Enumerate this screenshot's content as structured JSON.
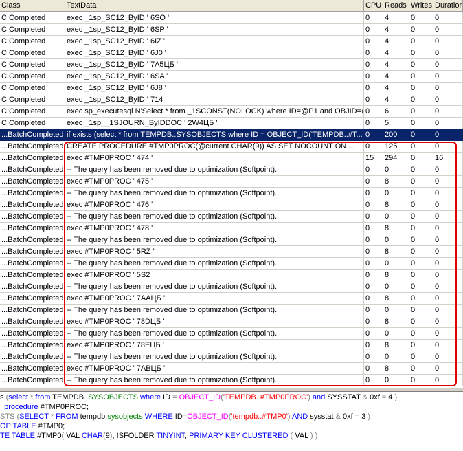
{
  "columns": [
    "Class",
    "TextData",
    "CPU",
    "Reads",
    "Writes",
    "Duration"
  ],
  "rows": [
    {
      "cls": "C:Completed",
      "text": "exec _1sp_SC12_ByID '    6SO    '",
      "cpu": "0",
      "reads": "4",
      "writes": "0",
      "duration": "0"
    },
    {
      "cls": "C:Completed",
      "text": "exec _1sp_SC12_ByID '    6SP    '",
      "cpu": "0",
      "reads": "4",
      "writes": "0",
      "duration": "0"
    },
    {
      "cls": "C:Completed",
      "text": "exec _1sp_SC12_ByID '    6IZ    '",
      "cpu": "0",
      "reads": "4",
      "writes": "0",
      "duration": "0"
    },
    {
      "cls": "C:Completed",
      "text": "exec _1sp_SC12_ByID '    6J0    '",
      "cpu": "0",
      "reads": "4",
      "writes": "0",
      "duration": "0"
    },
    {
      "cls": "C:Completed",
      "text": "exec _1sp_SC12_ByID '    7A5ЦБ '",
      "cpu": "0",
      "reads": "4",
      "writes": "0",
      "duration": "0"
    },
    {
      "cls": "C:Completed",
      "text": "exec _1sp_SC12_ByID '    6SA    '",
      "cpu": "0",
      "reads": "4",
      "writes": "0",
      "duration": "0"
    },
    {
      "cls": "C:Completed",
      "text": "exec _1sp_SC12_ByID '    6J8    '",
      "cpu": "0",
      "reads": "4",
      "writes": "0",
      "duration": "0"
    },
    {
      "cls": "C:Completed",
      "text": "exec _1sp_SC12_ByID '    714    '",
      "cpu": "0",
      "reads": "4",
      "writes": "0",
      "duration": "0"
    },
    {
      "cls": "C:Completed",
      "text": "exec sp_executesql N'Select * from _1SCONST(NOLOCK) where ID=@P1 and OBJID=@...",
      "cpu": "0",
      "reads": "6",
      "writes": "0",
      "duration": "0"
    },
    {
      "cls": "C:Completed",
      "text": "exec _1sp__1SJOURN_ByIDDOC '    2W4ЦБ '",
      "cpu": "0",
      "reads": "5",
      "writes": "0",
      "duration": "0"
    },
    {
      "cls": "...BatchCompleted",
      "text": "if exists (select * from TEMPDB..SYSOBJECTS where ID = OBJECT_ID('TEMPDB..#T...",
      "cpu": "0",
      "reads": "200",
      "writes": "0",
      "duration": "0",
      "selected": true
    },
    {
      "cls": "...BatchCompleted",
      "text": "CREATE PROCEDURE #TMP0PROC(@current CHAR(9)) AS     SET NOCOUNT ON   ...",
      "cpu": "0",
      "reads": "125",
      "writes": "0",
      "duration": "0"
    },
    {
      "cls": "...BatchCompleted",
      "text": "exec #TMP0PROC '    474    '",
      "cpu": "15",
      "reads": "294",
      "writes": "0",
      "duration": "16"
    },
    {
      "cls": "...BatchCompleted",
      "text": "-- The query has been removed due to optimization (Softpoint).",
      "cpu": "0",
      "reads": "0",
      "writes": "0",
      "duration": "0"
    },
    {
      "cls": "...BatchCompleted",
      "text": "exec #TMP0PROC '    475    '",
      "cpu": "0",
      "reads": "8",
      "writes": "0",
      "duration": "0"
    },
    {
      "cls": "...BatchCompleted",
      "text": "-- The query has been removed due to optimization (Softpoint).",
      "cpu": "0",
      "reads": "0",
      "writes": "0",
      "duration": "0"
    },
    {
      "cls": "...BatchCompleted",
      "text": "exec #TMP0PROC '    476    '",
      "cpu": "0",
      "reads": "8",
      "writes": "0",
      "duration": "0"
    },
    {
      "cls": "...BatchCompleted",
      "text": "-- The query has been removed due to optimization (Softpoint).",
      "cpu": "0",
      "reads": "0",
      "writes": "0",
      "duration": "0"
    },
    {
      "cls": "...BatchCompleted",
      "text": "exec #TMP0PROC '    478    '",
      "cpu": "0",
      "reads": "8",
      "writes": "0",
      "duration": "0"
    },
    {
      "cls": "...BatchCompleted",
      "text": "-- The query has been removed due to optimization (Softpoint).",
      "cpu": "0",
      "reads": "0",
      "writes": "0",
      "duration": "0"
    },
    {
      "cls": "...BatchCompleted",
      "text": "exec #TMP0PROC '    5RZ    '",
      "cpu": "0",
      "reads": "8",
      "writes": "0",
      "duration": "0"
    },
    {
      "cls": "...BatchCompleted",
      "text": "-- The query has been removed due to optimization (Softpoint).",
      "cpu": "0",
      "reads": "0",
      "writes": "0",
      "duration": "0"
    },
    {
      "cls": "...BatchCompleted",
      "text": "exec #TMP0PROC '    5S2    '",
      "cpu": "0",
      "reads": "8",
      "writes": "0",
      "duration": "0"
    },
    {
      "cls": "...BatchCompleted",
      "text": "-- The query has been removed due to optimization (Softpoint).",
      "cpu": "0",
      "reads": "0",
      "writes": "0",
      "duration": "0"
    },
    {
      "cls": "...BatchCompleted",
      "text": "exec #TMP0PROC '    7AAЦБ '",
      "cpu": "0",
      "reads": "8",
      "writes": "0",
      "duration": "0"
    },
    {
      "cls": "...BatchCompleted",
      "text": "-- The query has been removed due to optimization (Softpoint).",
      "cpu": "0",
      "reads": "0",
      "writes": "0",
      "duration": "0"
    },
    {
      "cls": "...BatchCompleted",
      "text": "exec #TMP0PROC '    78DЦБ '",
      "cpu": "0",
      "reads": "8",
      "writes": "0",
      "duration": "0"
    },
    {
      "cls": "...BatchCompleted",
      "text": "-- The query has been removed due to optimization (Softpoint).",
      "cpu": "0",
      "reads": "0",
      "writes": "0",
      "duration": "0"
    },
    {
      "cls": "...BatchCompleted",
      "text": "exec #TMP0PROC '    78EЦБ '",
      "cpu": "0",
      "reads": "8",
      "writes": "0",
      "duration": "0"
    },
    {
      "cls": "...BatchCompleted",
      "text": "-- The query has been removed due to optimization (Softpoint).",
      "cpu": "0",
      "reads": "0",
      "writes": "0",
      "duration": "0"
    },
    {
      "cls": "...BatchCompleted",
      "text": "exec #TMP0PROC '    7ABЦБ '",
      "cpu": "0",
      "reads": "8",
      "writes": "0",
      "duration": "0"
    },
    {
      "cls": "...BatchCompleted",
      "text": "-- The query has been removed due to optimization (Softpoint).",
      "cpu": "0",
      "reads": "0",
      "writes": "0",
      "duration": "0"
    }
  ],
  "sql_lines": [
    [
      [
        "t",
        "s "
      ],
      [
        "o",
        "("
      ],
      [
        "k",
        "select"
      ],
      [
        "o",
        " * "
      ],
      [
        "k",
        "from"
      ],
      [
        "t",
        " TEMPDB"
      ],
      [
        "o",
        ".."
      ],
      [
        "g",
        "SYSOBJECTS"
      ],
      [
        "k",
        " where"
      ],
      [
        "t",
        " ID "
      ],
      [
        "o",
        "="
      ],
      [
        "f",
        " OBJECT_ID"
      ],
      [
        "o",
        "("
      ],
      [
        "s",
        "'TEMPDB..#TMP0PROC'"
      ],
      [
        "o",
        ")"
      ],
      [
        "k",
        " and"
      ],
      [
        "t",
        " SYSSTAT "
      ],
      [
        "o",
        "&"
      ],
      [
        "t",
        " 0xf "
      ],
      [
        "o",
        "="
      ],
      [
        "t",
        " 4 "
      ],
      [
        "o",
        ")"
      ]
    ],
    [
      [
        "k",
        "  procedure"
      ],
      [
        "t",
        " #TMP0PROC;"
      ]
    ],
    [
      [
        "o",
        "STS"
      ],
      [
        "o",
        " ("
      ],
      [
        "k",
        "SELECT"
      ],
      [
        "o",
        " * "
      ],
      [
        "k",
        "FROM"
      ],
      [
        "t",
        " tempdb"
      ],
      [
        "o",
        "."
      ],
      [
        "g",
        "sysobjects"
      ],
      [
        "k",
        " WHERE"
      ],
      [
        "t",
        " ID"
      ],
      [
        "o",
        "="
      ],
      [
        "f",
        "OBJECT_ID"
      ],
      [
        "o",
        "("
      ],
      [
        "s",
        "'tempdb..#TMP0'"
      ],
      [
        "o",
        ")"
      ],
      [
        "k",
        " AND"
      ],
      [
        "t",
        " sysstat "
      ],
      [
        "o",
        "&"
      ],
      [
        "t",
        " 0xf "
      ],
      [
        "o",
        "="
      ],
      [
        "t",
        " 3 "
      ],
      [
        "o",
        ")"
      ]
    ],
    [
      [
        "k",
        "OP TABLE"
      ],
      [
        "t",
        " #TMP0;"
      ]
    ],
    [
      [
        "k",
        "TE TABLE"
      ],
      [
        "t",
        " #TMP0"
      ],
      [
        "o",
        "("
      ],
      [
        "t",
        " VAL "
      ],
      [
        "k",
        "CHAR"
      ],
      [
        "o",
        "("
      ],
      [
        "t",
        "9"
      ],
      [
        "o",
        ")"
      ],
      [
        "t",
        ", ISFOLDER "
      ],
      [
        "k",
        "TINYINT"
      ],
      [
        "t",
        ", "
      ],
      [
        "k",
        "PRIMARY KEY CLUSTERED"
      ],
      [
        "o",
        " ("
      ],
      [
        "t",
        " VAL "
      ],
      [
        "o",
        ")"
      ],
      [
        "o",
        " )"
      ]
    ]
  ]
}
